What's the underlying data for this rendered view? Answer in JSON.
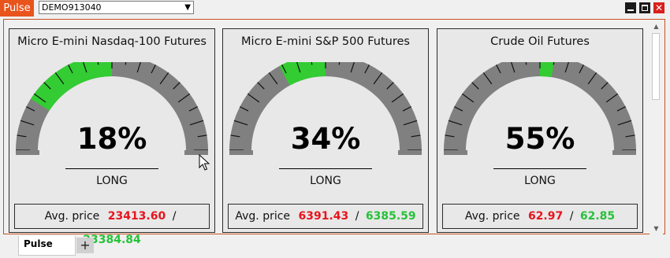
{
  "app": {
    "tab_label": "Pulse"
  },
  "account": {
    "selected": "DEMO913040"
  },
  "window_controls": {
    "minimize_icon": "minimize-icon",
    "maximize_icon": "maximize-icon",
    "close_icon": "close-icon",
    "close_glyph": "✕"
  },
  "colors": {
    "accent": "#e8541c",
    "gauge_gray": "#808080",
    "gauge_fill": "#33cc33",
    "short_price": "#e8141e",
    "long_price": "#26c23a"
  },
  "panels": [
    {
      "title": "Micro E-mini Nasdaq-100 Futures",
      "percent_text": "18%",
      "percent_value": 18,
      "direction": "LONG",
      "avg_label": "Avg. price",
      "price_red": "23413.60",
      "separator": "/",
      "price_green": "23384.84"
    },
    {
      "title": "Micro E-mini S&P 500 Futures",
      "percent_text": "34%",
      "percent_value": 34,
      "direction": "LONG",
      "avg_label": "Avg. price",
      "price_red": "6391.43",
      "separator": "/",
      "price_green": "6385.59"
    },
    {
      "title": "Crude Oil Futures",
      "percent_text": "55%",
      "percent_value": 55,
      "direction": "LONG",
      "avg_label": "Avg. price",
      "price_red": "62.97",
      "separator": "/",
      "price_green": "62.85"
    }
  ],
  "bottom_tabs": {
    "active": "Pulse",
    "add_label": "+"
  },
  "scrollbar": {
    "up_glyph": "▲",
    "down_glyph": "▼"
  }
}
